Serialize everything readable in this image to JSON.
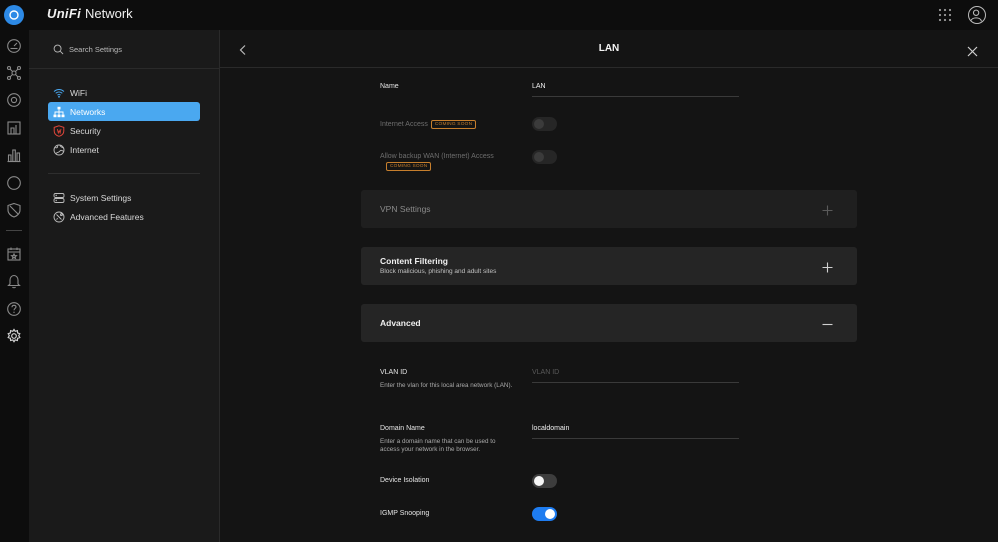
{
  "brand": {
    "logo_text": "UniFi",
    "product": "Network"
  },
  "sidebar": {
    "search_placeholder": "Search Settings",
    "items": [
      {
        "label": "WiFi",
        "icon": "wifi-icon"
      },
      {
        "label": "Networks",
        "icon": "network-icon",
        "active": true
      },
      {
        "label": "Security",
        "icon": "shield-icon"
      },
      {
        "label": "Internet",
        "icon": "globe-icon"
      }
    ],
    "items2": [
      {
        "label": "System Settings",
        "icon": "server-icon"
      },
      {
        "label": "Advanced Features",
        "icon": "tools-icon"
      }
    ]
  },
  "header": {
    "title": "LAN"
  },
  "form": {
    "name": {
      "label": "Name",
      "value": "LAN"
    },
    "internet_access": {
      "label": "Internet Access",
      "badge": "COMING SOON"
    },
    "backup_wan": {
      "label": "Allow backup WAN (Internet) Access",
      "badge": "COMING SOON"
    },
    "vpn": {
      "title": "VPN Settings"
    },
    "content_filtering": {
      "title": "Content Filtering",
      "subtitle": "Block malicious, phishing and adult sites"
    },
    "advanced": {
      "title": "Advanced"
    },
    "vlan_id": {
      "label": "VLAN ID",
      "description": "Enter the vlan for this local area network (LAN).",
      "placeholder": "VLAN ID"
    },
    "domain_name": {
      "label": "Domain Name",
      "description": "Enter a domain name that can be used to access your network in the browser.",
      "value": "localdomain"
    },
    "device_isolation": {
      "label": "Device Isolation",
      "enabled": false
    },
    "igmp_snooping": {
      "label": "IGMP Snooping",
      "enabled": true
    }
  },
  "colors": {
    "accent": "#1e7cf0",
    "nav_active": "#4aa8f0",
    "badge": "#c77f2d"
  }
}
